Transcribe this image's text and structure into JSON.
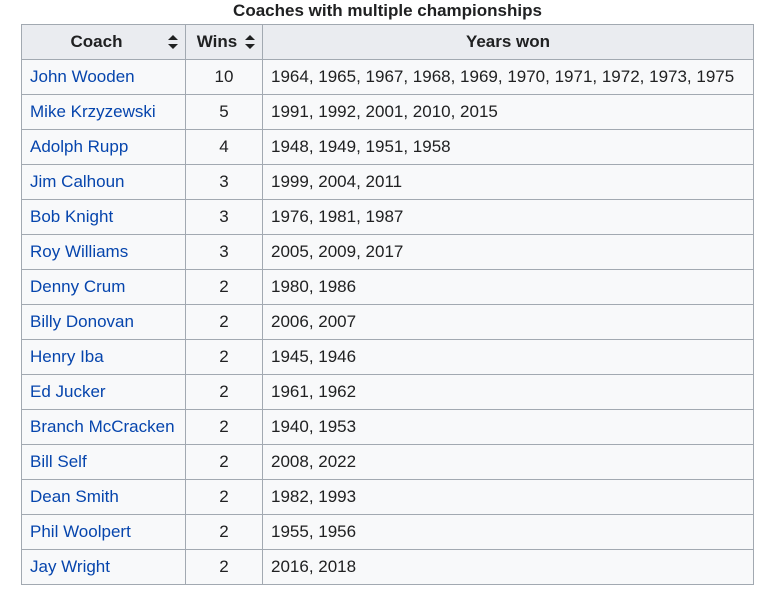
{
  "caption": "Coaches with multiple championships",
  "columns": [
    {
      "label": "Coach",
      "sortable": true
    },
    {
      "label": "Wins",
      "sortable": true
    },
    {
      "label": "Years won",
      "sortable": false
    }
  ],
  "rows": [
    {
      "coach": "John Wooden",
      "wins": "10",
      "years": "1964, 1965, 1967, 1968, 1969, 1970, 1971, 1972, 1973, 1975"
    },
    {
      "coach": "Mike Krzyzewski",
      "wins": "5",
      "years": "1991, 1992, 2001, 2010, 2015"
    },
    {
      "coach": "Adolph Rupp",
      "wins": "4",
      "years": "1948, 1949, 1951, 1958"
    },
    {
      "coach": "Jim Calhoun",
      "wins": "3",
      "years": "1999, 2004, 2011"
    },
    {
      "coach": "Bob Knight",
      "wins": "3",
      "years": "1976, 1981, 1987"
    },
    {
      "coach": "Roy Williams",
      "wins": "3",
      "years": "2005, 2009, 2017"
    },
    {
      "coach": "Denny Crum",
      "wins": "2",
      "years": "1980, 1986"
    },
    {
      "coach": "Billy Donovan",
      "wins": "2",
      "years": "2006, 2007"
    },
    {
      "coach": "Henry Iba",
      "wins": "2",
      "years": "1945, 1946"
    },
    {
      "coach": "Ed Jucker",
      "wins": "2",
      "years": "1961, 1962"
    },
    {
      "coach": "Branch McCracken",
      "wins": "2",
      "years": "1940, 1953"
    },
    {
      "coach": "Bill Self",
      "wins": "2",
      "years": "2008, 2022"
    },
    {
      "coach": "Dean Smith",
      "wins": "2",
      "years": "1982, 1993"
    },
    {
      "coach": "Phil Woolpert",
      "wins": "2",
      "years": "1955, 1956"
    },
    {
      "coach": "Jay Wright",
      "wins": "2",
      "years": "2016, 2018"
    }
  ],
  "colors": {
    "link": "#0645ad",
    "header_bg": "#eaecf0",
    "cell_bg": "#f8f9fa",
    "border": "#a2a9b1",
    "text": "#202122"
  },
  "icons": {
    "sort": "sort-arrows-icon"
  }
}
